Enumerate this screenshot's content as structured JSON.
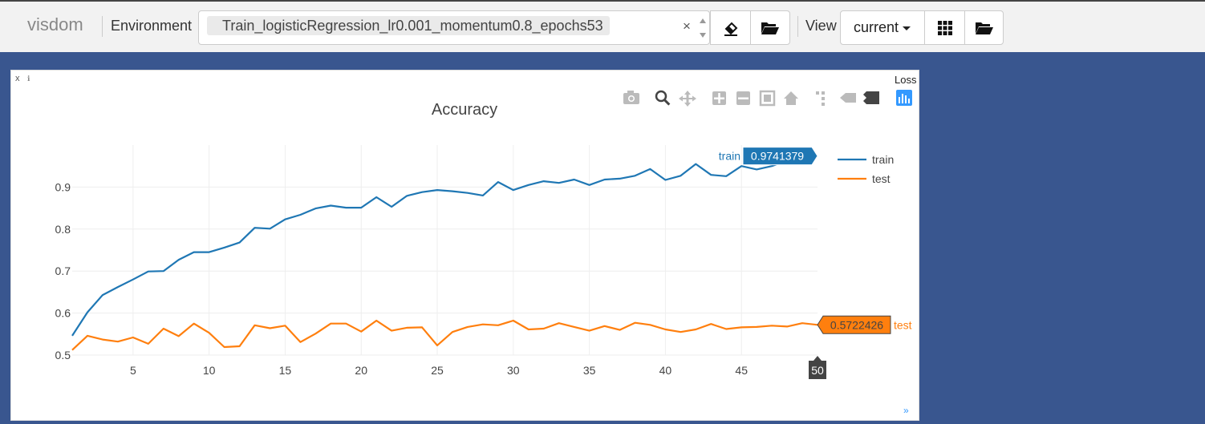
{
  "app": {
    "brand": "visdom"
  },
  "toolbar": {
    "environment_label": "Environment",
    "environment_value": "Train_logisticRegression_lr0.001_momentum0.8_epochs53",
    "clear_glyph": "×",
    "view_label": "View",
    "view_value": "current"
  },
  "pane": {
    "close_glyph": "x",
    "pin_glyph": "ℹ",
    "title": "Loss",
    "resize_glyph": "»"
  },
  "colors": {
    "train": "#1f77b4",
    "test": "#ff7f0e",
    "background": "#39568f",
    "toolbar": "#f2f2f2"
  },
  "chart_data": {
    "type": "line",
    "title": "Accuracy",
    "xlabel": "",
    "ylabel": "",
    "xlim": [
      1,
      50
    ],
    "ylim": [
      0.5,
      1.0
    ],
    "x_ticks": [
      5,
      10,
      15,
      20,
      25,
      30,
      35,
      40,
      45
    ],
    "y_ticks": [
      0.5,
      0.6,
      0.7,
      0.8,
      0.9
    ],
    "grid": true,
    "legend": "top-right",
    "hover": {
      "x_label": "50",
      "train_value": "0.9741379",
      "test_value": "0.5722426"
    },
    "x": [
      1,
      2,
      3,
      4,
      5,
      6,
      7,
      8,
      9,
      10,
      11,
      12,
      13,
      14,
      15,
      16,
      17,
      18,
      19,
      20,
      21,
      22,
      23,
      24,
      25,
      26,
      27,
      28,
      29,
      30,
      31,
      32,
      33,
      34,
      35,
      36,
      37,
      38,
      39,
      40,
      41,
      42,
      43,
      44,
      45,
      46,
      47,
      48,
      49,
      50
    ],
    "series": [
      {
        "name": "train",
        "color": "#1f77b4",
        "values": [
          0.546,
          0.602,
          0.643,
          0.662,
          0.68,
          0.699,
          0.7,
          0.727,
          0.745,
          0.745,
          0.756,
          0.768,
          0.803,
          0.801,
          0.823,
          0.834,
          0.849,
          0.856,
          0.851,
          0.851,
          0.876,
          0.853,
          0.879,
          0.888,
          0.893,
          0.89,
          0.886,
          0.88,
          0.912,
          0.893,
          0.905,
          0.914,
          0.91,
          0.918,
          0.905,
          0.918,
          0.92,
          0.927,
          0.943,
          0.917,
          0.927,
          0.955,
          0.929,
          0.926,
          0.95,
          0.942,
          0.95,
          0.963,
          0.97,
          0.974
        ]
      },
      {
        "name": "test",
        "color": "#ff7f0e",
        "values": [
          0.512,
          0.546,
          0.537,
          0.532,
          0.542,
          0.527,
          0.563,
          0.545,
          0.575,
          0.553,
          0.519,
          0.521,
          0.571,
          0.564,
          0.57,
          0.531,
          0.551,
          0.575,
          0.575,
          0.556,
          0.582,
          0.558,
          0.565,
          0.566,
          0.523,
          0.555,
          0.567,
          0.573,
          0.571,
          0.582,
          0.561,
          0.563,
          0.576,
          0.567,
          0.558,
          0.569,
          0.56,
          0.577,
          0.572,
          0.561,
          0.555,
          0.561,
          0.574,
          0.562,
          0.566,
          0.567,
          0.57,
          0.568,
          0.576,
          0.572
        ]
      }
    ]
  }
}
